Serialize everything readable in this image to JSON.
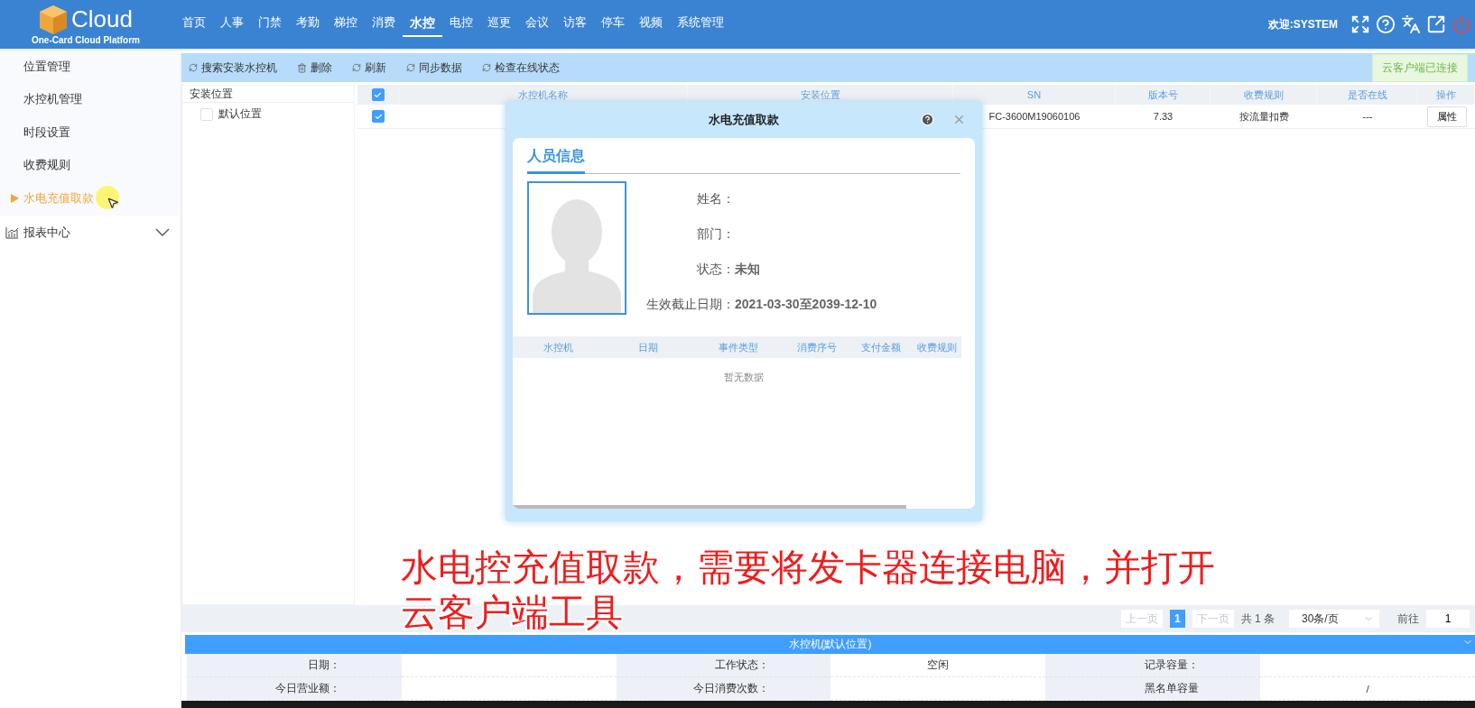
{
  "header": {
    "logo_text": "Cloud",
    "logo_subtitle": "One-Card Cloud Platform",
    "welcome": "欢迎:SYSTEM",
    "nav": [
      {
        "label": "首页",
        "selected": false
      },
      {
        "label": "人事",
        "selected": false
      },
      {
        "label": "门禁",
        "selected": false
      },
      {
        "label": "考勤",
        "selected": false
      },
      {
        "label": "梯控",
        "selected": false
      },
      {
        "label": "消费",
        "selected": false
      },
      {
        "label": "水控",
        "selected": true
      },
      {
        "label": "电控",
        "selected": false
      },
      {
        "label": "巡更",
        "selected": false
      },
      {
        "label": "会议",
        "selected": false
      },
      {
        "label": "访客",
        "selected": false
      },
      {
        "label": "停车",
        "selected": false
      },
      {
        "label": "视频",
        "selected": false
      },
      {
        "label": "系统管理",
        "selected": false
      }
    ]
  },
  "sidebar": {
    "items": [
      {
        "label": "位置管理",
        "selected": false
      },
      {
        "label": "水控机管理",
        "selected": false
      },
      {
        "label": "时段设置",
        "selected": false
      },
      {
        "label": "收费规则",
        "selected": false
      },
      {
        "label": "水电充值取款",
        "selected": true
      }
    ],
    "groups": [
      {
        "label": "报表中心",
        "expanded": false
      }
    ]
  },
  "toolbar": {
    "actions": [
      {
        "label": "搜索安装水控机",
        "kind": "refresh"
      },
      {
        "label": "删除",
        "kind": "delete"
      },
      {
        "label": "刷新",
        "kind": "refresh"
      },
      {
        "label": "同步数据",
        "kind": "refresh"
      },
      {
        "label": "检查在线状态",
        "kind": "refresh"
      }
    ],
    "status": "云客户端已连接"
  },
  "tree": {
    "title": "安装位置",
    "items": [
      {
        "label": "默认位置",
        "checked": false
      }
    ]
  },
  "table": {
    "all_checked": true,
    "columns": [
      "水控机名称",
      "安装位置",
      "SN",
      "版本号",
      "收费规则",
      "是否在线",
      "操作"
    ],
    "rows": [
      {
        "checked": true,
        "cells": [
          "",
          "",
          "FC-3600M19060106",
          "7.33",
          "按流量扣费",
          "---"
        ],
        "action": "属性"
      }
    ]
  },
  "pagination": {
    "prev": {
      "label": "上一页",
      "disabled": true
    },
    "pages": [
      {
        "label": "1",
        "selected": true
      }
    ],
    "next": {
      "label": "下一页",
      "disabled": true
    },
    "total": "共 1 条",
    "page_size": "30条/页",
    "goto_label": "前往",
    "goto_value": "1"
  },
  "detail": {
    "title": "水控机(默认位置)",
    "expanded": true,
    "rows": [
      [
        {
          "label": "日期："
        },
        {
          "label": "工作状态：",
          "value": "空闲"
        },
        {
          "label": "记录容量："
        }
      ],
      [
        {
          "label": "今日营业额："
        },
        {
          "label": "今日消费次数："
        },
        {
          "label": "黑名单容量",
          "value": "/"
        }
      ]
    ]
  },
  "dialog": {
    "title": "水电充值取款",
    "tab": "人员信息",
    "fields": [
      {
        "label": "姓名："
      },
      {
        "label": "部门："
      },
      {
        "label": "状态：",
        "value": "未知"
      },
      {
        "label": "生效截止日期：",
        "value": "2021-03-30至2039-12-10"
      }
    ],
    "columns": [
      "水控机",
      "日期",
      "事件类型",
      "消费序号",
      "支付金额",
      "收费规则"
    ],
    "empty_text": "暂无数据"
  },
  "caption": [
    "水电控充值取款，需要将发卡器连接电脑，并打开",
    "云客户端工具"
  ]
}
